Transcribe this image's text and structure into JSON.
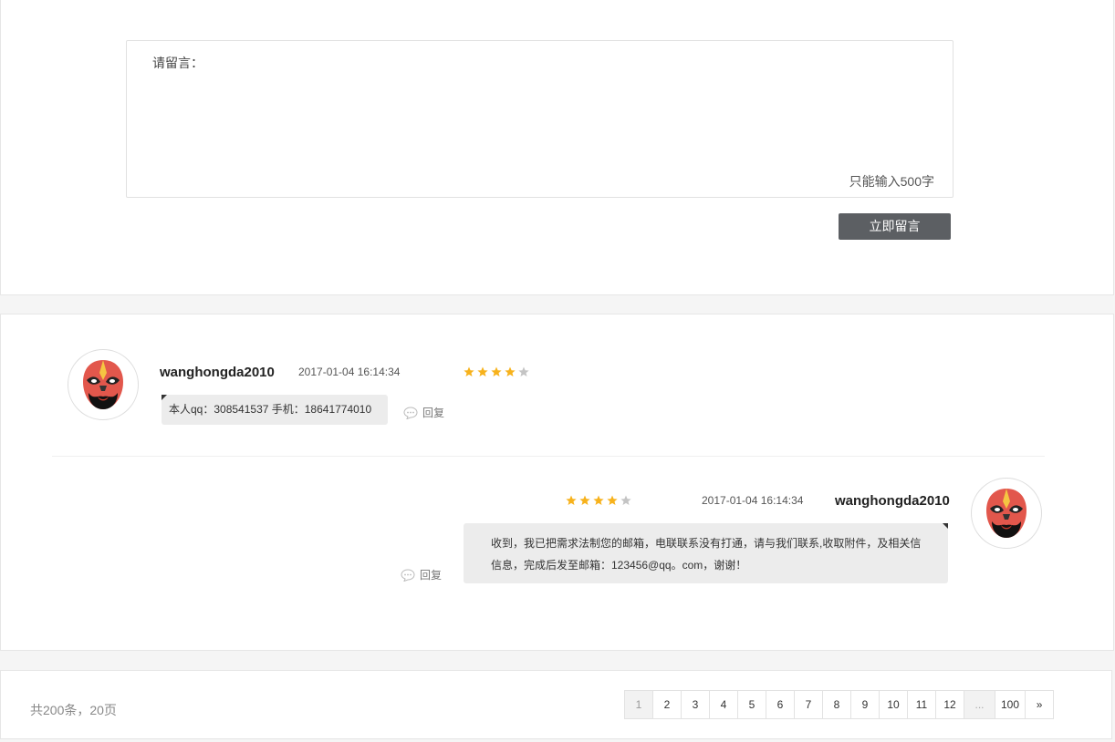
{
  "form": {
    "label": "请留言：",
    "input_value": "",
    "limit_text": "只能输入500字",
    "submit_label": "立即留言"
  },
  "comments": [
    {
      "username": "wanghongda2010",
      "time": "2017-01-04 16:14:34",
      "rating": 4,
      "max_rating": 5,
      "text": "本人qq：308541537 手机：18641774010",
      "reply_label": "回复",
      "avatar_icon": "peking-opera-mask-icon"
    },
    {
      "username": "wanghongda2010",
      "time": "2017-01-04 16:14:34",
      "rating": 4,
      "max_rating": 5,
      "text_line1": "收到，我已把需求法制您的邮箱，电联联系没有打通，请与我们联系,收取附件，及相关信",
      "text_line2": "信息，完成后发至邮箱：123456@qq。com，谢谢！",
      "reply_label": "回复",
      "avatar_icon": "peking-opera-mask-icon"
    }
  ],
  "pagination": {
    "total_text": "共200条，20页",
    "pages": [
      "1",
      "2",
      "3",
      "4",
      "5",
      "6",
      "7",
      "8",
      "9",
      "10",
      "11",
      "12",
      "...",
      "100",
      "»"
    ],
    "current": "1"
  },
  "colors": {
    "star_filled": "#f7b21c",
    "star_empty": "#c4c4c4",
    "button_bg": "#5c5f63"
  }
}
